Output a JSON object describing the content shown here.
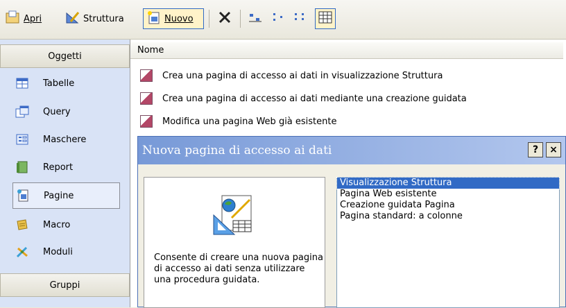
{
  "toolbar": {
    "open_label": "Apri",
    "design_label": "Struttura",
    "new_label": "Nuovo",
    "icons": [
      "open-icon",
      "design-icon",
      "new-icon",
      "delete-icon",
      "large-icons-icon",
      "small-icons-icon",
      "list-view-icon",
      "details-view-icon"
    ]
  },
  "leftpane": {
    "objects_header": "Oggetti",
    "groups_header": "Gruppi",
    "items": [
      {
        "label": "Tabelle"
      },
      {
        "label": "Query"
      },
      {
        "label": "Maschere"
      },
      {
        "label": "Report"
      },
      {
        "label": "Pagine"
      },
      {
        "label": "Macro"
      },
      {
        "label": "Moduli"
      }
    ]
  },
  "main": {
    "column_header": "Nome",
    "rows": [
      "Crea una pagina di accesso ai dati in visualizzazione Struttura",
      "Crea una pagina di accesso ai dati mediante una creazione guidata",
      "Modifica una pagina Web già esistente"
    ]
  },
  "dialog": {
    "title": "Nuova pagina di accesso ai dati",
    "help_label": "?",
    "close_label": "×",
    "description": "Consente di creare una nuova pagina di accesso ai dati senza utilizzare una procedura guidata.",
    "options": [
      "Visualizzazione Struttura",
      "Pagina Web esistente",
      "Creazione guidata Pagina",
      "Pagina standard: a colonne"
    ],
    "selected_option": "Visualizzazione Struttura"
  },
  "colors": {
    "selection": "#316ac5",
    "title_start": "#7799d7",
    "title_end": "#b3c7ee",
    "pane_bg": "#d9e3f6"
  }
}
